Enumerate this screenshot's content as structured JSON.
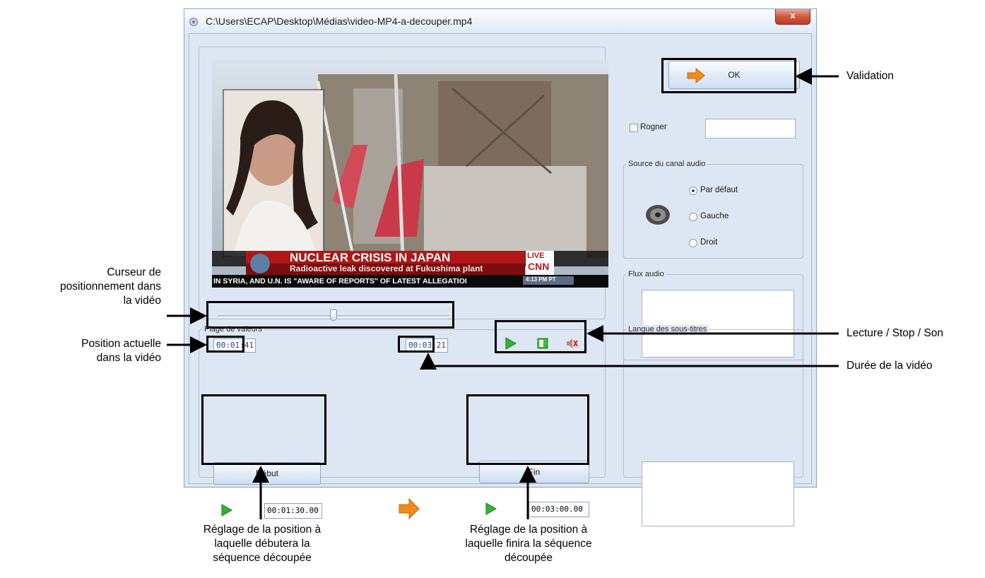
{
  "window": {
    "title": "C:\\Users\\ECAP\\Desktop\\Médias\\video-MP4-a-decouper.mp4",
    "close_label": "x"
  },
  "video": {
    "headline": "NUCLEAR CRISIS IN JAPAN",
    "subline": "Radioactive leak discovered at Fukushima plant",
    "ticker": "IN SYRIA, AND U.N. IS \"AWARE OF REPORTS\" OF LATEST ALLEGATIOI",
    "live_badge": "LIVE",
    "network": "CNN",
    "clock": "4:13 PM PT"
  },
  "playback": {
    "current_position": "00:01:41",
    "duration": "00:03:21",
    "slider_fraction": 0.5
  },
  "ok_button": {
    "label": "OK"
  },
  "crop": {
    "label": "Rogner",
    "checked": false,
    "value": ""
  },
  "audio_source": {
    "legend": "Source du canal audio",
    "options": [
      "Par défaut",
      "Gauche",
      "Droit"
    ],
    "selected": "Par défaut"
  },
  "audio_streams": {
    "legend": "Flux audio"
  },
  "subtitles": {
    "legend": "Langue des sous-titres"
  },
  "range": {
    "legend": "Plage de valeurs",
    "start_label": "Début",
    "start_value": "00:01:30.00",
    "end_label": "Fin",
    "end_value": "00:03:00.00"
  },
  "annotations": {
    "validation": "Validation",
    "cursor": [
      "Curseur de",
      "positionnement dans",
      "la vidéo"
    ],
    "position": [
      "Position actuelle",
      "dans la vidéo"
    ],
    "controls": "Lecture / Stop / Son",
    "duration": "Durée de la vidéo",
    "start_setting": [
      "Réglage de la position à",
      "laquelle débutera la",
      "séquence découpée"
    ],
    "end_setting": [
      "Réglage de la position à",
      "laquelle finira la séquence",
      "découpée"
    ]
  },
  "colors": {
    "window_bg": "#dde7f3",
    "time_text": "#1f3f8a",
    "play_green": "#2fb52f",
    "arrow_orange": "#f08a1c"
  }
}
